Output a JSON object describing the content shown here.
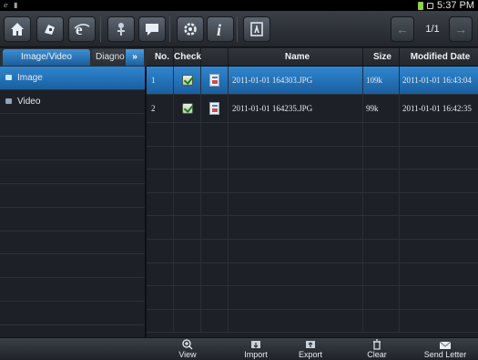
{
  "status_bar": {
    "left_icons": [
      "notification-icon",
      "notification-icon"
    ],
    "time": "5:37 PM"
  },
  "toolbar": {
    "buttons": [
      "home-icon",
      "vehicle-icon",
      "browser-icon",
      "pin-icon",
      "message-icon",
      "settings-icon",
      "info-icon",
      "exit-icon"
    ],
    "pager": {
      "prev_icon": "arrow-left-icon",
      "page": "1/1",
      "next_icon": "arrow-right-icon"
    }
  },
  "left_panel": {
    "tabs": [
      {
        "label": "Image/Video",
        "active": true
      },
      {
        "label": "Diagnose",
        "active": false
      }
    ],
    "more_label": "»",
    "items": [
      {
        "label": "Image",
        "selected": true
      },
      {
        "label": "Video",
        "selected": false
      }
    ]
  },
  "table": {
    "columns": [
      "No.",
      "Check",
      "",
      "Name",
      "Size",
      "Modified Date"
    ],
    "rows": [
      {
        "no": "1",
        "checked": true,
        "icon": "image-file-icon",
        "name": "2011-01-01 164303.JPG",
        "size": "109k",
        "date": "2011-01-01 16:43:04",
        "selected": true
      },
      {
        "no": "2",
        "checked": true,
        "icon": "image-file-icon",
        "name": "2011-01-01 164235.JPG",
        "size": "99k",
        "date": "2011-01-01 16:42:35",
        "selected": false
      }
    ]
  },
  "bottom_bar": {
    "buttons": [
      {
        "label": "View",
        "icon": "zoom-icon"
      },
      {
        "label": "Import",
        "icon": "import-icon"
      },
      {
        "label": "Export",
        "icon": "export-icon"
      },
      {
        "label": "Clear",
        "icon": "trash-icon"
      },
      {
        "label": "Send Letter",
        "icon": "envelope-icon"
      }
    ]
  },
  "colors": {
    "accent": "#2f86d0",
    "background": "#1d2127",
    "toolbar": "#2e3339"
  }
}
